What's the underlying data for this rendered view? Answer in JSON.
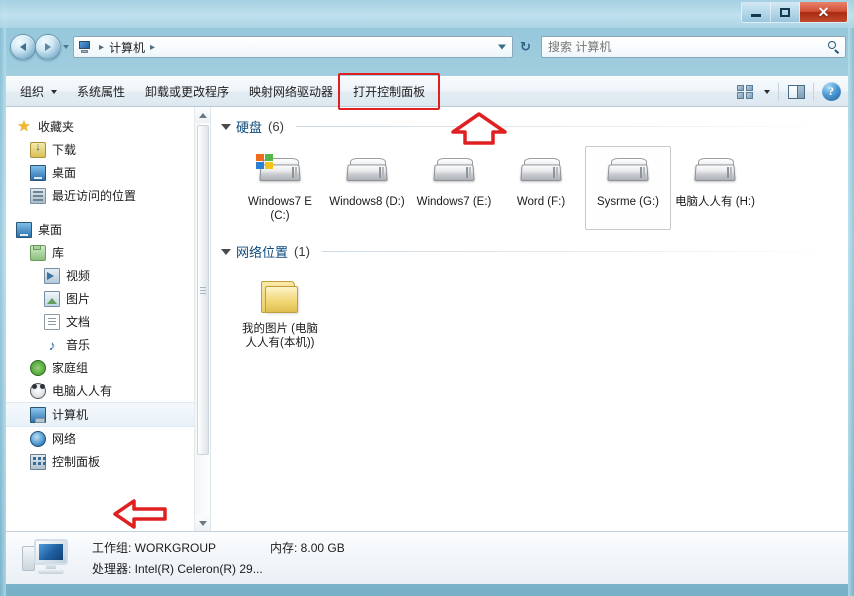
{
  "window": {
    "controls": {
      "minimize": "minimize-button",
      "maximize": "maximize-button",
      "close": "✕"
    }
  },
  "nav": {
    "back_title": "后退",
    "forward_title": "前进",
    "address": {
      "icon": "computer-icon",
      "crumbs": [
        "计算机"
      ],
      "separator": "▸",
      "trailing_separator": "▸"
    },
    "refresh": "↻",
    "search": {
      "placeholder": "搜索 计算机",
      "value": ""
    }
  },
  "toolbar": {
    "items": [
      {
        "label": "组织",
        "has_caret": true,
        "highlighted": false
      },
      {
        "label": "系统属性",
        "has_caret": false,
        "highlighted": false
      },
      {
        "label": "卸载或更改程序",
        "has_caret": false,
        "highlighted": false
      },
      {
        "label": "映射网络驱动器",
        "has_caret": false,
        "highlighted": false
      },
      {
        "label": "打开控制面板",
        "has_caret": false,
        "highlighted": true
      }
    ],
    "view_button": "views-icon",
    "pane_button": "preview-pane-icon",
    "help_button": "?"
  },
  "annotations": {
    "accent_color": "#e02020",
    "arrow_toolbar": "up-arrow pointing at 打开控制面板",
    "arrow_sidebar": "left-arrow pointing at 控制面板"
  },
  "sidebar": {
    "items": [
      {
        "label": "收藏夹",
        "icon": "star-icon",
        "indent": 0,
        "selected": false
      },
      {
        "label": "下载",
        "icon": "download-icon",
        "indent": 1,
        "selected": false
      },
      {
        "label": "桌面",
        "icon": "desktop-icon",
        "indent": 1,
        "selected": false
      },
      {
        "label": "最近访问的位置",
        "icon": "recent-places-icon",
        "indent": 1,
        "selected": false
      },
      {
        "label": "桌面",
        "icon": "desktop-icon",
        "indent": 0,
        "selected": false,
        "gap_before": true
      },
      {
        "label": "库",
        "icon": "library-icon",
        "indent": 1,
        "selected": false
      },
      {
        "label": "视频",
        "icon": "video-icon",
        "indent": 2,
        "selected": false
      },
      {
        "label": "图片",
        "icon": "picture-icon",
        "indent": 2,
        "selected": false
      },
      {
        "label": "文档",
        "icon": "document-icon",
        "indent": 2,
        "selected": false
      },
      {
        "label": "音乐",
        "icon": "music-icon",
        "indent": 2,
        "selected": false
      },
      {
        "label": "家庭组",
        "icon": "homegroup-icon",
        "indent": 1,
        "selected": false
      },
      {
        "label": "电脑人人有",
        "icon": "user-panda-icon",
        "indent": 1,
        "selected": false
      },
      {
        "label": "计算机",
        "icon": "computer-icon",
        "indent": 1,
        "selected": true
      },
      {
        "label": "网络",
        "icon": "network-icon",
        "indent": 1,
        "selected": false
      },
      {
        "label": "控制面板",
        "icon": "control-panel-icon",
        "indent": 1,
        "selected": false
      }
    ]
  },
  "main": {
    "groups": [
      {
        "title": "硬盘",
        "count": "(6)",
        "items": [
          {
            "name": "Windows7 E (C:)",
            "icon": "hard-drive-system-icon",
            "selected": false
          },
          {
            "name": "Windows8 (D:)",
            "icon": "hard-drive-icon",
            "selected": false
          },
          {
            "name": "Windows7 (E:)",
            "icon": "hard-drive-icon",
            "selected": false
          },
          {
            "name": "Word (F:)",
            "icon": "hard-drive-icon",
            "selected": false
          },
          {
            "name": "Sysrme (G:)",
            "icon": "hard-drive-icon",
            "selected": true
          },
          {
            "name": "电脑人人有 (H:)",
            "icon": "hard-drive-icon",
            "selected": false
          }
        ]
      },
      {
        "title": "网络位置",
        "count": "(1)",
        "items": [
          {
            "name": "我的图片 (电脑人人有(本机))",
            "icon": "folder-icon",
            "selected": false
          }
        ]
      }
    ]
  },
  "statusbar": {
    "icon": "computer-icon",
    "line1_field1": "工作组: WORKGROUP",
    "line1_field2": "内存: 8.00 GB",
    "line2_field1": "处理器: Intel(R) Celeron(R) 29..."
  }
}
